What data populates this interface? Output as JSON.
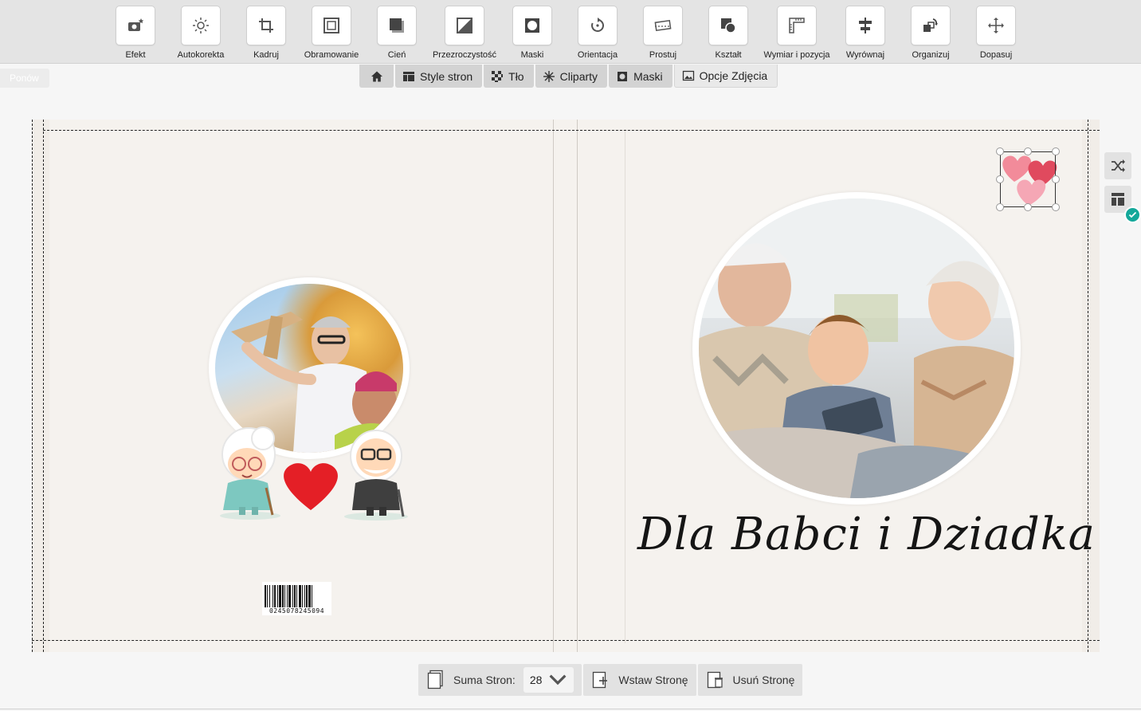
{
  "toolbar": {
    "tools": [
      {
        "id": "efekt",
        "label": "Efekt",
        "icon": "camera-star-icon"
      },
      {
        "id": "autokorekta",
        "label": "Autokorekta",
        "icon": "sun-icon"
      },
      {
        "id": "kadruj",
        "label": "Kadruj",
        "icon": "crop-icon"
      },
      {
        "id": "obramowanie",
        "label": "Obramowanie",
        "icon": "frame-icon"
      },
      {
        "id": "cien",
        "label": "Cień",
        "icon": "shadow-icon"
      },
      {
        "id": "przezroczystosc",
        "label": "Przezroczystość",
        "icon": "transparency-icon"
      },
      {
        "id": "maski",
        "label": "Maski",
        "icon": "mask-icon"
      },
      {
        "id": "orientacja",
        "label": "Orientacja",
        "icon": "rotate-icon"
      },
      {
        "id": "prostuj",
        "label": "Prostuj",
        "icon": "straighten-icon"
      },
      {
        "id": "ksztalt",
        "label": "Kształt",
        "icon": "shape-icon"
      },
      {
        "id": "wymiar",
        "label": "Wymiar i pozycja",
        "icon": "ruler-icon"
      },
      {
        "id": "wyrownaj",
        "label": "Wyrównaj",
        "icon": "align-icon"
      },
      {
        "id": "organizuj",
        "label": "Organizuj",
        "icon": "arrange-icon"
      },
      {
        "id": "dopasuj",
        "label": "Dopasuj",
        "icon": "move-icon"
      }
    ]
  },
  "faded_tag": "Ponów",
  "subtabs": {
    "home_icon": "home-icon",
    "style_stron": "Style stron",
    "tlo": "Tło",
    "cliparty": "Cliparty",
    "maski": "Maski",
    "opcje_zdjecia": "Opcje Zdjęcia"
  },
  "page": {
    "title": "Dla Babci i Dziadka",
    "barcode_number": "0245078245094"
  },
  "bottom": {
    "pages_label": "Suma Stron:",
    "pages_value": "28",
    "insert_label": "Wstaw Stronę",
    "delete_label": "Usuń Stronę"
  },
  "colors": {
    "accent_check": "#14a89a",
    "heart_red": "#e41f26",
    "heart_pink": "#f28b9a",
    "page_bg": "#f5f2ee"
  }
}
